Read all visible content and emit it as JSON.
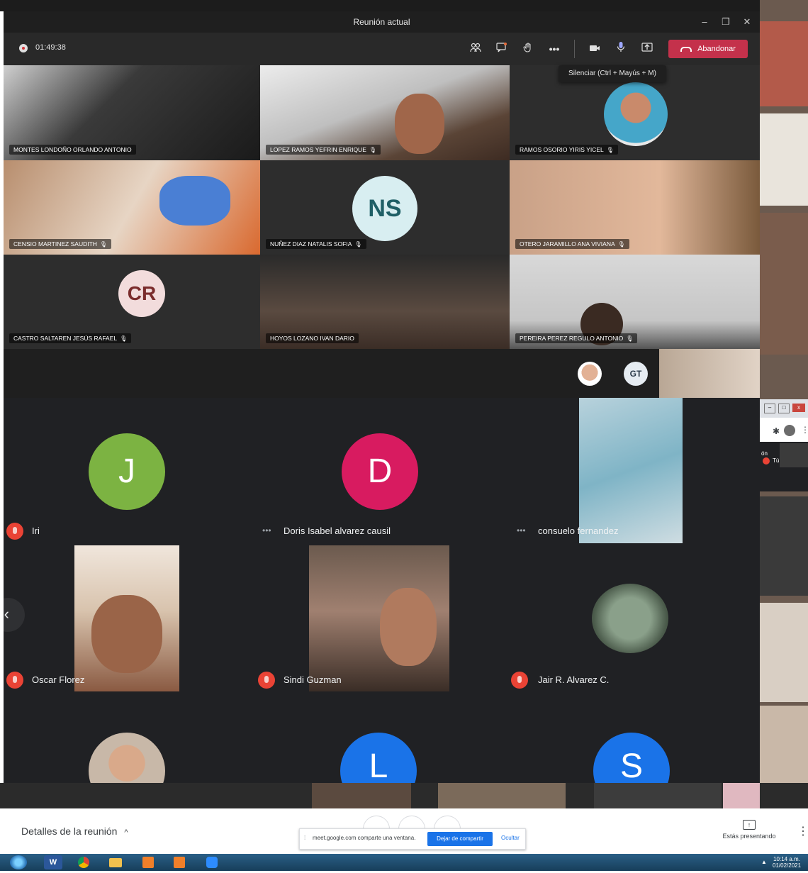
{
  "teams": {
    "title": "Reunión actual",
    "timer": "01:49:38",
    "window_controls": [
      "–",
      "❐",
      "✕"
    ],
    "leave_label": "Abandonar",
    "tooltip": "Silenciar (Ctrl + Mayús + M)",
    "participants": [
      {
        "name": "MONTES LONDOÑO ORLANDO ANTONIO",
        "mic": ""
      },
      {
        "name": "LOPEZ RAMOS YEFRIN ENRIQUE",
        "mic": "🎙"
      },
      {
        "name": "RAMOS OSORIO YIRIS YICEL",
        "mic": "🎙"
      },
      {
        "name": "CENSIO MARTINEZ SAUDITH",
        "mic": "🎙"
      },
      {
        "name": "NUÑEZ DIAZ NATALIS SOFIA",
        "mic": "🎙",
        "initials": "NS"
      },
      {
        "name": "OTERO JARAMILLO ANA VIVIANA",
        "mic": "🎙"
      },
      {
        "name": "CASTRO SALTAREN JESÚS RAFAEL",
        "mic": "🎙",
        "initials": "CR"
      },
      {
        "name": "HOYOS LOZANO IVAN DARIO",
        "mic": ""
      },
      {
        "name": "PEREIRA PEREZ REGULO ANTONIO",
        "mic": "🎙"
      }
    ],
    "overflow_initials": "GT"
  },
  "meet": {
    "tiles": [
      {
        "name": "Iri",
        "initial": "J",
        "color": "#7cb342"
      },
      {
        "name": "Doris Isabel alvarez causil",
        "initial": "D",
        "color": "#d81b60"
      },
      {
        "name": "consuelo fernandez"
      },
      {
        "name": "Oscar Florez"
      },
      {
        "name": "Sindi Guzman"
      },
      {
        "name": "Jair R. Alvarez C."
      }
    ],
    "bottom_initials": [
      "L",
      "S"
    ],
    "bottom_colors": [
      "#1a73e8",
      "#1a73e8"
    ],
    "details_label": "Detalles de la reunión",
    "share_notice": "meet.google.com comparte una ventana.",
    "stop_sharing": "Dejar de compartir",
    "hide": "Ocultar",
    "presenting": "Estás presentando",
    "chrome_fragment": {
      "text1": "ón",
      "text2": "Tú"
    }
  },
  "taskbar": {
    "time": "10:14 a.m.",
    "date": "01/02/2021",
    "apps": [
      "start",
      "word",
      "chrome",
      "explorer",
      "app1",
      "app2",
      "zoom"
    ]
  },
  "colors": {
    "teams_bg": "#292929",
    "leave_red": "#c4314b",
    "meet_bg": "#202124",
    "meet_blue": "#1a73e8"
  }
}
